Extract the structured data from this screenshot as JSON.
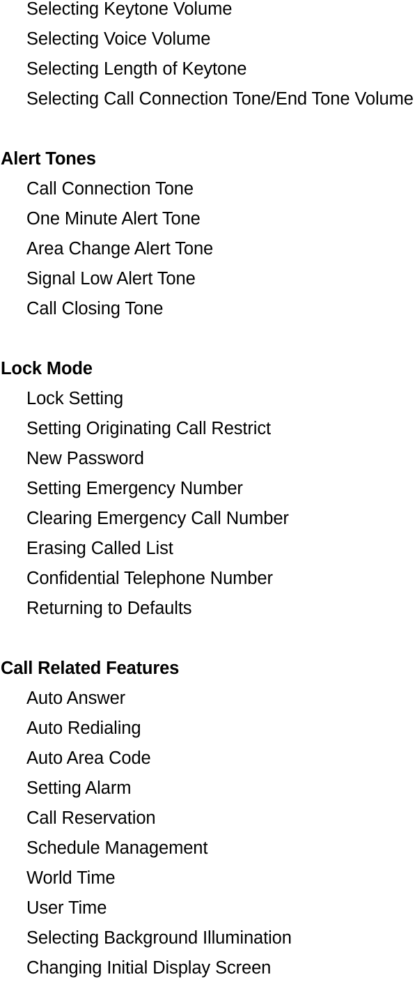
{
  "document": {
    "type": "table-of-contents",
    "sections": [
      {
        "heading": null,
        "items": [
          "Selecting Keytone Volume",
          "Selecting Voice Volume",
          "Selecting Length of Keytone",
          "Selecting Call Connection Tone/End Tone Volume"
        ]
      },
      {
        "heading": "Alert Tones",
        "items": [
          "Call Connection Tone",
          "One Minute Alert Tone",
          "Area Change Alert Tone",
          "Signal Low Alert Tone",
          "Call Closing Tone"
        ]
      },
      {
        "heading": "Lock Mode",
        "items": [
          "Lock Setting",
          "Setting Originating Call Restrict",
          "New Password",
          "Setting Emergency Number",
          "Clearing Emergency Call Number",
          "Erasing Called List",
          "Confidential Telephone Number",
          "Returning to Defaults"
        ]
      },
      {
        "heading": "Call Related Features",
        "items": [
          "Auto Answer",
          "Auto Redialing",
          "Auto Area Code",
          "Setting Alarm",
          "Call Reservation",
          "Schedule Management",
          "World Time",
          "User Time",
          "Selecting Background Illumination",
          "Changing Initial Display Screen"
        ]
      }
    ]
  }
}
